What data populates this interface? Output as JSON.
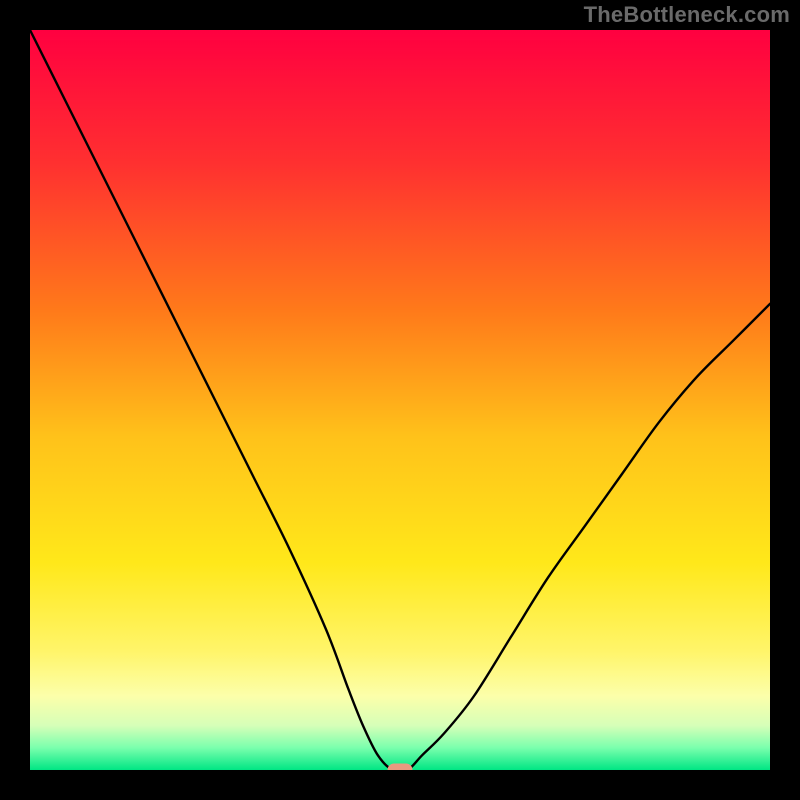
{
  "watermark": "TheBottleneck.com",
  "colors": {
    "marker": "#ea9a80",
    "curve": "#000000",
    "gradient_stops": [
      {
        "offset": "0%",
        "color": "#ff0040"
      },
      {
        "offset": "18%",
        "color": "#ff3030"
      },
      {
        "offset": "38%",
        "color": "#ff7a1a"
      },
      {
        "offset": "55%",
        "color": "#ffc21a"
      },
      {
        "offset": "72%",
        "color": "#ffe81a"
      },
      {
        "offset": "84%",
        "color": "#fff56a"
      },
      {
        "offset": "90%",
        "color": "#fcffaa"
      },
      {
        "offset": "94%",
        "color": "#d6ffb8"
      },
      {
        "offset": "97%",
        "color": "#7affad"
      },
      {
        "offset": "100%",
        "color": "#00e684"
      }
    ]
  },
  "chart_data": {
    "type": "line",
    "title": "",
    "xlabel": "",
    "ylabel": "",
    "xlim": [
      0,
      100
    ],
    "ylim": [
      0,
      100
    ],
    "series": [
      {
        "name": "bottleneck_curve",
        "x": [
          0,
          5,
          10,
          15,
          20,
          25,
          30,
          35,
          40,
          43,
          45,
          47,
          49,
          51,
          53,
          56,
          60,
          65,
          70,
          75,
          80,
          85,
          90,
          95,
          100
        ],
        "y": [
          100,
          90,
          80,
          70,
          60,
          50,
          40,
          30,
          19,
          11,
          6,
          2,
          0,
          0,
          2,
          5,
          10,
          18,
          26,
          33,
          40,
          47,
          53,
          58,
          63
        ]
      }
    ],
    "marker": {
      "x": 50,
      "y": 0
    }
  }
}
